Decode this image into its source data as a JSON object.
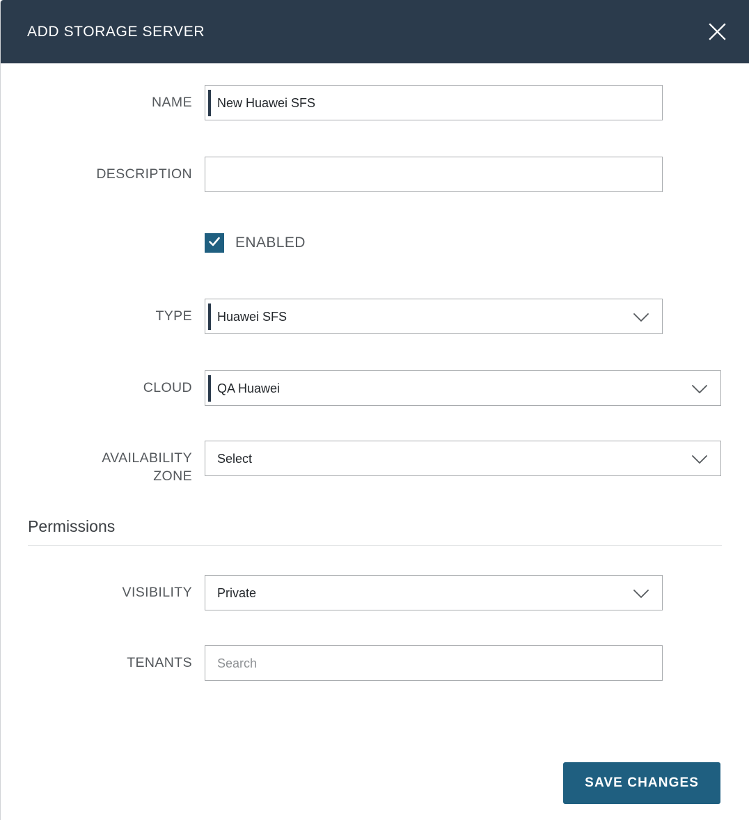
{
  "header": {
    "title": "ADD STORAGE SERVER",
    "close_icon": "close-icon"
  },
  "colors": {
    "header_bg": "#2b3b4c",
    "accent": "#1f5f80",
    "field_border": "#a8abae",
    "label_text": "#55595d",
    "placeholder_text": "#8e9194"
  },
  "fields": {
    "name": {
      "label": "NAME",
      "value": "New Huawei SFS",
      "placeholder": "",
      "required": true
    },
    "description": {
      "label": "DESCRIPTION",
      "value": "",
      "placeholder": "",
      "required": false
    },
    "enabled": {
      "label": "ENABLED",
      "checked": true,
      "check_icon": "checkmark-icon"
    },
    "type": {
      "label": "TYPE",
      "value": "Huawei SFS",
      "required": true,
      "chevron_icon": "chevron-down-icon"
    },
    "cloud": {
      "label": "CLOUD",
      "value": "QA Huawei",
      "required": true,
      "chevron_icon": "chevron-down-icon"
    },
    "availability_zone": {
      "label": "AVAILABILITY\nZONE",
      "value": "Select",
      "required": false,
      "chevron_icon": "chevron-down-icon"
    },
    "visibility": {
      "label": "VISIBILITY",
      "value": "Private",
      "required": false,
      "chevron_icon": "chevron-down-icon"
    },
    "tenants": {
      "label": "TENANTS",
      "value": "",
      "placeholder": "Search",
      "required": false
    }
  },
  "permissions_section": {
    "title": "Permissions"
  },
  "footer": {
    "save_label": "SAVE CHANGES"
  }
}
